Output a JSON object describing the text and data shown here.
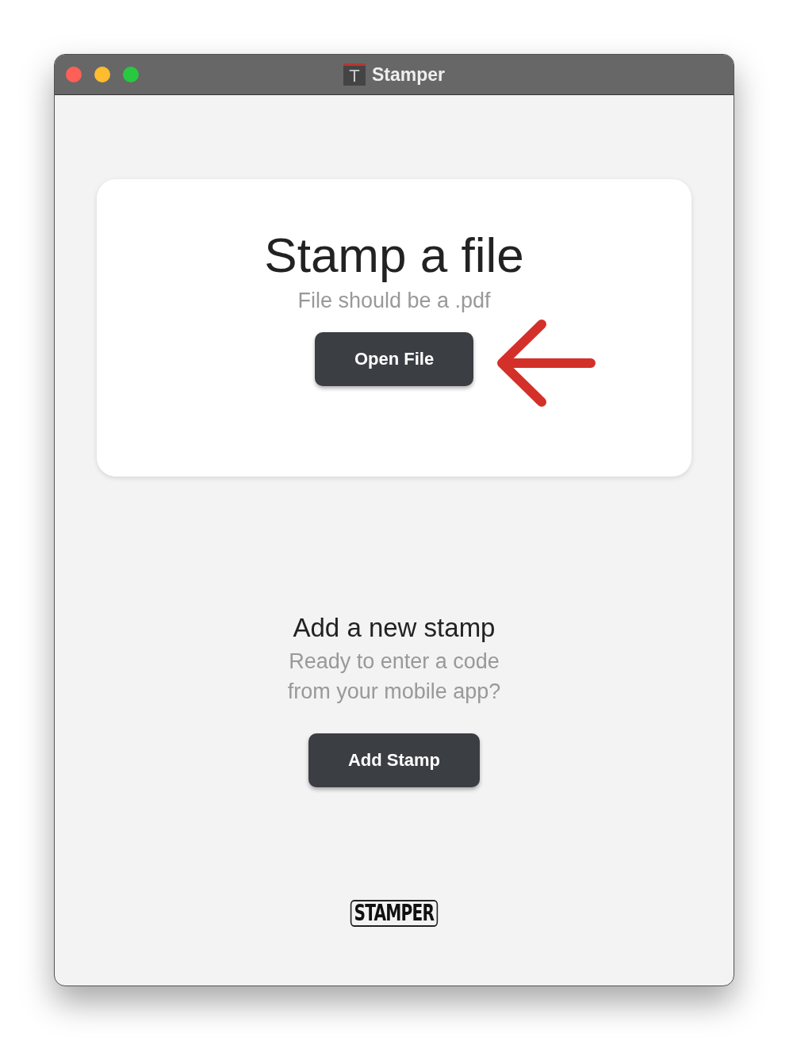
{
  "window": {
    "title": "Stamper",
    "icon_letter": "T"
  },
  "stamp_card": {
    "title": "Stamp a file",
    "subtitle": "File should be a .pdf",
    "button": "Open File"
  },
  "add_stamp": {
    "title": "Add a new stamp",
    "subtitle_lines": [
      "Ready to enter a code",
      "from your mobile app?"
    ],
    "button": "Add Stamp"
  },
  "footer": {
    "logo": "STAMPER"
  }
}
